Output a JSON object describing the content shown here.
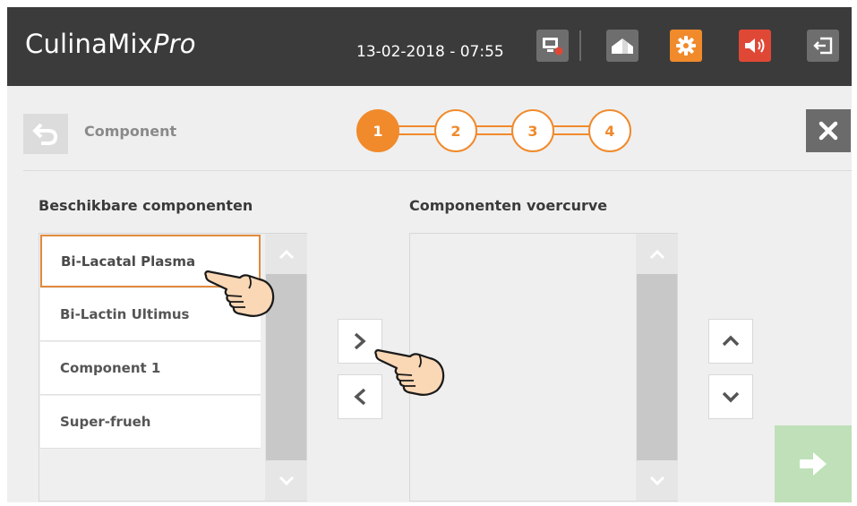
{
  "header": {
    "app_name_main": "CulinaMix",
    "app_name_suffix": "Pro",
    "datetime": "13-02-2018 - 07:55",
    "icons": [
      "screen-warning-icon",
      "home-icon",
      "gear-icon",
      "speaker-icon",
      "logout-icon"
    ],
    "colors": {
      "bar": "#3b3b3b",
      "settings": "#f08a2b",
      "sound": "#e04836",
      "neutral": "#6e6e6e"
    }
  },
  "page": {
    "title": "Component",
    "steps": [
      "1",
      "2",
      "3",
      "4"
    ],
    "active_step": "1",
    "accent_color": "#f08a2b"
  },
  "available": {
    "title": "Beschikbare componenten",
    "items": [
      "Bi-Lacatal Plasma",
      "Bi-Lactin Ultimus",
      "Component 1",
      "Super-frueh"
    ],
    "selected": "Bi-Lacatal Plasma"
  },
  "curve": {
    "title": "Componenten voercurve",
    "items": []
  },
  "actions": {
    "icons": [
      "chevron-right-icon",
      "chevron-left-icon",
      "chevron-up-icon",
      "chevron-down-icon",
      "arrow-right-icon",
      "close-icon",
      "back-icon"
    ],
    "next_color": "#bfe0b8"
  }
}
